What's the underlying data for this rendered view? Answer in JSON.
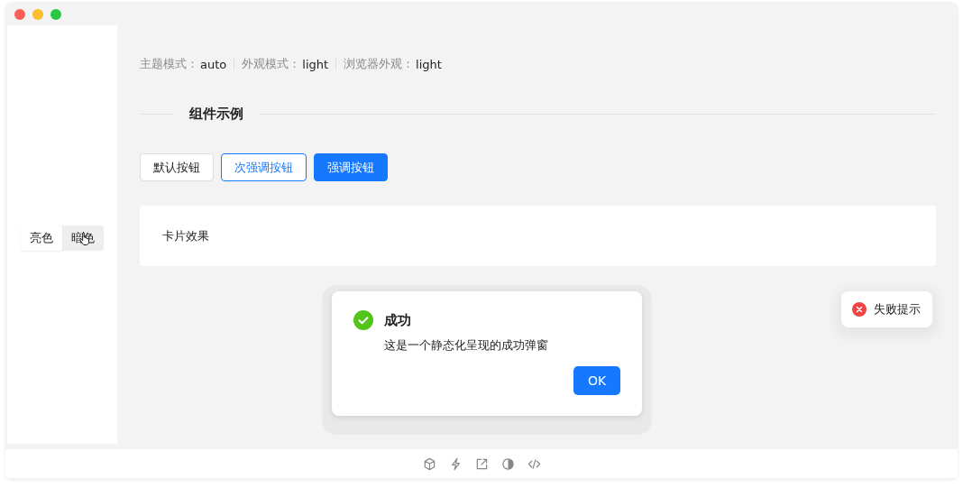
{
  "sidebar": {
    "theme_toggle": [
      {
        "label": "亮色",
        "selected": true
      },
      {
        "label": "暗色",
        "selected": false
      }
    ]
  },
  "status": [
    {
      "label": "主题模式：",
      "value": "auto"
    },
    {
      "label": "外观模式：",
      "value": "light"
    },
    {
      "label": "浏览器外观：",
      "value": "light"
    }
  ],
  "section_title": "组件示例",
  "buttons": [
    {
      "label": "默认按钮",
      "kind": "default"
    },
    {
      "label": "次强调按钮",
      "kind": "secondary"
    },
    {
      "label": "强调按钮",
      "kind": "primary"
    }
  ],
  "card": {
    "text": "卡片效果"
  },
  "dialog": {
    "title": "成功",
    "message": "这是一个静态化呈现的成功弹窗",
    "button": "OK"
  },
  "toast": {
    "text": "失败提示"
  }
}
